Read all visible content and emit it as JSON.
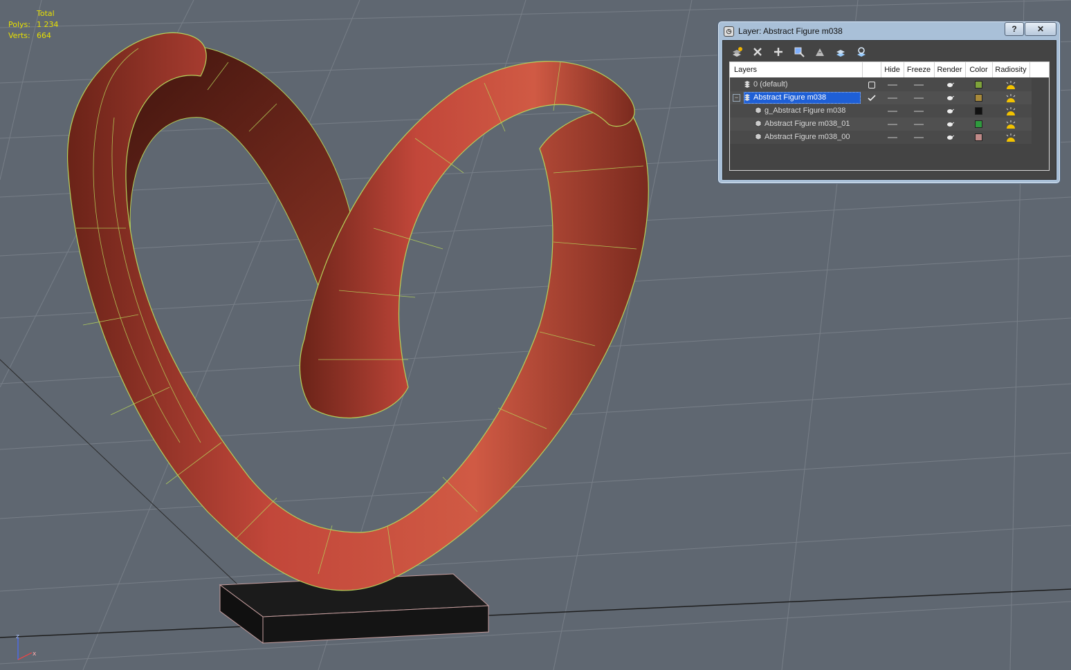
{
  "stats": {
    "header": "Total",
    "polys_label": "Polys:",
    "polys_value": "1 234",
    "verts_label": "Verts:",
    "verts_value": "664"
  },
  "axis": {
    "z_label": "z",
    "x_label": "x"
  },
  "colors": {
    "viewport_bg": "#5f6771",
    "figure": "#c2473a",
    "wire": "#b6d35a",
    "stats_text": "#e8e100",
    "selection": "#1e5fd6"
  },
  "dialog": {
    "title": "Layer: Abstract Figure m038",
    "help_label": "?",
    "close_label": "✕",
    "toolbar": [
      "create-layer-icon",
      "delete-layer-icon",
      "add-to-layer-icon",
      "select-objects-icon",
      "highlight-layer-icon",
      "hide-all-icon",
      "freeze-all-icon"
    ],
    "columns": {
      "layers": "Layers",
      "hide": "Hide",
      "freeze": "Freeze",
      "render": "Render",
      "color": "Color",
      "radiosity": "Radiosity"
    },
    "rows": [
      {
        "name": "0 (default)",
        "swatch": "#7fa33a",
        "current": false
      },
      {
        "name": "Abstract Figure m038",
        "swatch": "#a88a3a",
        "current": true
      },
      {
        "name": "g_Abstract Figure m038",
        "swatch": "#111111",
        "current": false
      },
      {
        "name": "Abstract Figure m038_01",
        "swatch": "#2f9b3e",
        "current": false
      },
      {
        "name": "Abstract Figure m038_00",
        "swatch": "#c08a88",
        "current": false
      }
    ]
  }
}
